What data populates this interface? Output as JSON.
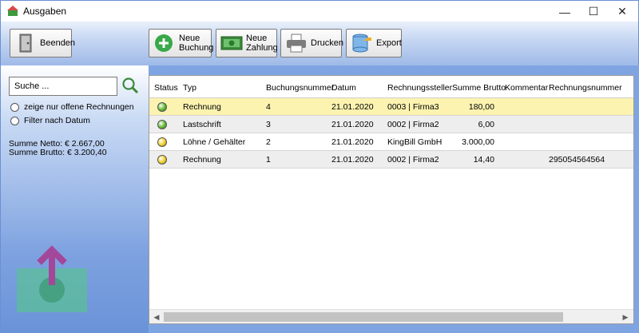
{
  "window": {
    "title": "Ausgaben",
    "min": "—",
    "max": "☐",
    "close": "✕"
  },
  "toolbar": {
    "quit_label": "Beenden",
    "new_booking_label": "Neue\nBuchung",
    "new_payment_label": "Neue\nZahlung",
    "print_label": "Drucken",
    "export_label": "Export"
  },
  "sidebar": {
    "search_placeholder": "Suche ...",
    "filter_open": "zeige nur offene Rechnungen",
    "filter_date": "Filter nach Datum",
    "sum_net": "Summe Netto: € 2.667,00",
    "sum_gross": "Summe Brutto: € 3.200,40"
  },
  "table": {
    "columns": [
      "Status",
      "Typ",
      "Buchungsnummer",
      "Datum",
      "Rechnungssteller",
      "Summe Brutto",
      "Kommentar",
      "Rechnungsnummer"
    ],
    "rows": [
      {
        "status": "green",
        "typ": "Rechnung",
        "nr": "4",
        "datum": "21.01.2020",
        "steller": "0003 | Firma3",
        "brutto": "180,00",
        "kommentar": "",
        "rnr": ""
      },
      {
        "status": "green",
        "typ": "Lastschrift",
        "nr": "3",
        "datum": "21.01.2020",
        "steller": "0002 | Firma2",
        "brutto": "6,00",
        "kommentar": "",
        "rnr": ""
      },
      {
        "status": "yellow",
        "typ": "Löhne / Gehälter",
        "nr": "2",
        "datum": "21.01.2020",
        "steller": "KingBill GmbH",
        "brutto": "3.000,00",
        "kommentar": "",
        "rnr": ""
      },
      {
        "status": "yellow",
        "typ": "Rechnung",
        "nr": "1",
        "datum": "21.01.2020",
        "steller": "0002 | Firma2",
        "brutto": "14,40",
        "kommentar": "",
        "rnr": "295054564564"
      }
    ]
  },
  "colors": {
    "green": "#5cb82a",
    "yellow": "#f0d020",
    "selected_row": "#fcf3b0"
  }
}
